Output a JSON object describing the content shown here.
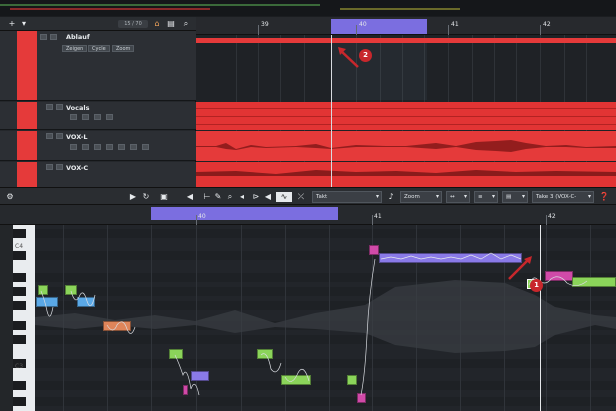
{
  "project": {
    "counter": "15 / 70",
    "tracks": [
      {
        "name": "Ablauf",
        "buttons": [
          "Zeigen",
          "Cycle",
          "Zoom"
        ],
        "color": "#e53a3a"
      },
      {
        "name": "Vocals",
        "color": "#e53a3a"
      },
      {
        "name": "VOX-L",
        "color": "#e53a3a"
      },
      {
        "name": "VOX-C",
        "color": "#e53a3a"
      }
    ],
    "ruler": {
      "bars": [
        "39",
        "40",
        "41",
        "42"
      ]
    },
    "annotations": [
      "2",
      "1"
    ]
  },
  "editor": {
    "grid_dropdown": "Takt",
    "zoom_dropdown": "Zoom",
    "take_dropdown": "Take 3 (VOX-C-",
    "ruler": {
      "bars": [
        "40",
        "41",
        "42"
      ]
    },
    "key_labels": [
      "C4",
      "C3"
    ]
  },
  "colors": {
    "track_red": "#e53a3a",
    "cycle_purple": "#7b6ee0",
    "note_green": "#8bd45a",
    "note_blue": "#5aa8e6",
    "note_orange": "#e0855a",
    "note_purple": "#8a7ae8",
    "note_pink": "#d04aa8",
    "annotation_red": "#c8272c"
  },
  "icons": [
    "add-track-icon",
    "folder-icon",
    "home-icon",
    "search-icon",
    "play-icon",
    "loop-icon",
    "pencil-icon",
    "magnifier-icon",
    "speaker-icon",
    "pointer-icon",
    "settings-icon"
  ]
}
